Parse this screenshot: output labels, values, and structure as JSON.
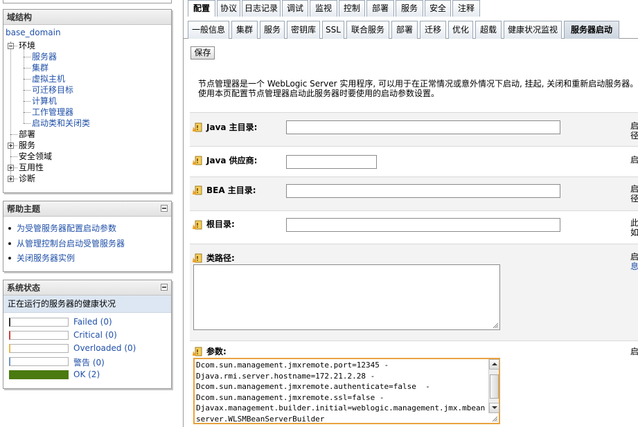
{
  "domain_tree": {
    "title": "域结构",
    "root": "base_domain",
    "nodes": [
      {
        "label": "环境",
        "expander": "minus",
        "level": 0
      },
      {
        "label": "服务器",
        "level": 1
      },
      {
        "label": "集群",
        "level": 1
      },
      {
        "label": "虚拟主机",
        "level": 1
      },
      {
        "label": "可迁移目标",
        "level": 1
      },
      {
        "label": "计算机",
        "level": 1
      },
      {
        "label": "工作管理器",
        "level": 1
      },
      {
        "label": "启动类和关闭类",
        "level": 1
      },
      {
        "label": "部署",
        "level": 0
      },
      {
        "label": "服务",
        "expander": "plus",
        "level": 0
      },
      {
        "label": "安全领域",
        "level": 0
      },
      {
        "label": "互用性",
        "expander": "plus",
        "level": 0
      },
      {
        "label": "诊断",
        "expander": "plus",
        "level": 0
      }
    ]
  },
  "help": {
    "title": "帮助主题",
    "items": [
      "为受管服务器配置启动参数",
      "从管理控制台启动受管服务器",
      "关闭服务器实例"
    ]
  },
  "system_status": {
    "title": "系统状态",
    "subtitle": "正在运行的服务器的健康状况",
    "rows": [
      {
        "label": "Failed (0)",
        "color": "#333333",
        "fraction": 0
      },
      {
        "label": "Critical (0)",
        "color": "#d23c3c",
        "fraction": 0
      },
      {
        "label": "Overloaded (0)",
        "color": "#f0b84a",
        "fraction": 0
      },
      {
        "label": "警告 (0)",
        "color": "#6f96c6",
        "fraction": 0
      },
      {
        "label": "OK (2)",
        "color": "#4a7a10",
        "fraction": 1
      }
    ]
  },
  "tabs_primary": [
    "配置",
    "协议",
    "日志记录",
    "调试",
    "监视",
    "控制",
    "部署",
    "服务",
    "安全",
    "注释"
  ],
  "tabs_primary_active": "配置",
  "tabs_secondary": [
    "一般信息",
    "集群",
    "服务",
    "密钥库",
    "SSL",
    "联合服务",
    "部署",
    "迁移",
    "优化",
    "超载",
    "健康状况监视",
    "服务器启动"
  ],
  "tabs_secondary_active": "服务器启动",
  "save_label": "保存",
  "description": "节点管理器是一个 WebLogic Server 实用程序, 可以用于在正常情况或意外情况下启动, 挂起, 关闭和重新启动服务器。使用本页配置节点管理器启动此服务器时要使用的启动参数设置。",
  "fields": {
    "java_home": {
      "label": "Java 主目录:",
      "value": "",
      "help": "启\n径"
    },
    "java_vendor": {
      "label": "Java 供应商:",
      "value": "",
      "help": "启"
    },
    "bea_home": {
      "label": "BEA 主目录:",
      "value": "",
      "help": "启\n径"
    },
    "root_dir": {
      "label": "根目录:",
      "value": "",
      "help": "此\n如"
    },
    "classpath": {
      "label": "类路径:",
      "value": "",
      "help": "启",
      "help_link": "息"
    },
    "arguments": {
      "label": "参数:",
      "value": "Dcom.sun.management.jmxremote.port=12345 -\nDjava.rmi.server.hostname=172.21.2.28 -\nDcom.sun.management.jmxremote.authenticate=false  -\nDcom.sun.management.jmxremote.ssl=false -\nDjavax.management.builder.initial=weblogic.management.jmx.mbeanserver.WLSMBeanServerBuilder",
      "help": "启"
    }
  },
  "icons": {
    "field_lock": "lock-warning-icon",
    "collapse": "collapse-icon"
  }
}
